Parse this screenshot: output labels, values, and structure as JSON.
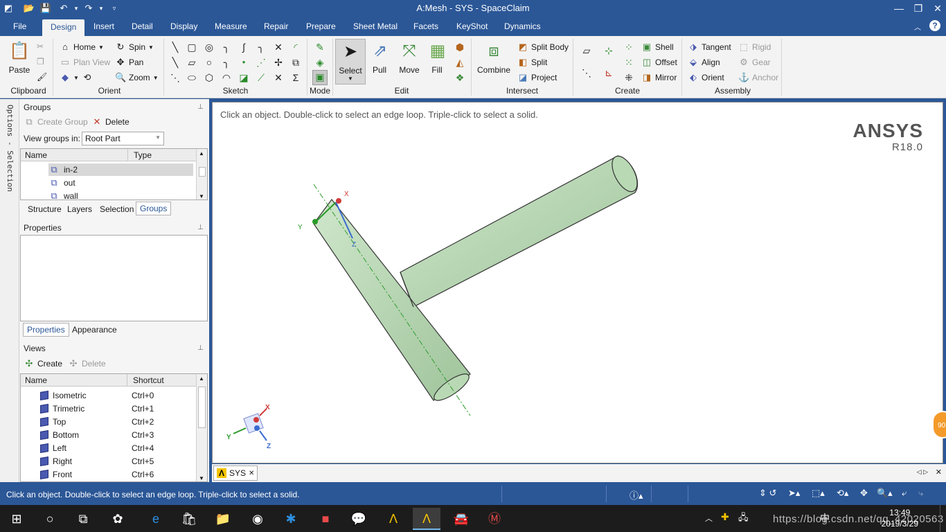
{
  "window": {
    "title": "A:Mesh - SYS - SpaceClaim"
  },
  "tabs": [
    "File",
    "Design",
    "Insert",
    "Detail",
    "Display",
    "Measure",
    "Repair",
    "Prepare",
    "Sheet Metal",
    "Facets",
    "KeyShot",
    "Dynamics"
  ],
  "active_tab": "Design",
  "ribbon": {
    "clipboard": {
      "label": "Clipboard",
      "paste": "Paste"
    },
    "orient": {
      "label": "Orient",
      "home": "Home",
      "spin": "Spin",
      "plan_view": "Plan View",
      "pan": "Pan",
      "zoom": "Zoom"
    },
    "sketch": {
      "label": "Sketch"
    },
    "mode": {
      "label": "Mode"
    },
    "edit": {
      "label": "Edit",
      "select": "Select",
      "pull": "Pull",
      "move": "Move",
      "fill": "Fill"
    },
    "intersect": {
      "label": "Intersect",
      "combine": "Combine",
      "split_body": "Split Body",
      "split": "Split",
      "project": "Project"
    },
    "create": {
      "label": "Create",
      "shell": "Shell",
      "offset": "Offset",
      "mirror": "Mirror"
    },
    "assembly": {
      "label": "Assembly",
      "tangent": "Tangent",
      "align": "Align",
      "orient": "Orient",
      "rigid": "Rigid",
      "gear": "Gear",
      "anchor": "Anchor"
    }
  },
  "left_strip": "Options - Selection",
  "groups_panel": {
    "title": "Groups",
    "create_group": "Create Group",
    "delete": "Delete",
    "view_groups_label": "View groups in:",
    "view_groups_value": "Root Part",
    "columns": [
      "Name",
      "Type"
    ],
    "rows": [
      "in-2",
      "out",
      "wall"
    ],
    "selected_row": "in-2",
    "tabs": [
      "Structure",
      "Layers",
      "Selection",
      "Groups"
    ],
    "active_tab": "Groups"
  },
  "properties_panel": {
    "title": "Properties",
    "tabs": [
      "Properties",
      "Appearance"
    ],
    "active_tab": "Properties"
  },
  "views_panel": {
    "title": "Views",
    "create": "Create",
    "delete": "Delete",
    "columns": [
      "Name",
      "Shortcut"
    ],
    "rows": [
      {
        "name": "Isometric",
        "shortcut": "Ctrl+0"
      },
      {
        "name": "Trimetric",
        "shortcut": "Ctrl+1"
      },
      {
        "name": "Top",
        "shortcut": "Ctrl+2"
      },
      {
        "name": "Bottom",
        "shortcut": "Ctrl+3"
      },
      {
        "name": "Left",
        "shortcut": "Ctrl+4"
      },
      {
        "name": "Right",
        "shortcut": "Ctrl+5"
      },
      {
        "name": "Front",
        "shortcut": "Ctrl+6"
      }
    ]
  },
  "viewport": {
    "hint": "Click an object. Double-click to select an edge loop. Triple-click to select a solid.",
    "brand": "ANSYS",
    "version": "R18.0",
    "axes": {
      "x": "X",
      "y": "Y",
      "z": "Z"
    },
    "body_color": "#b9d9b4"
  },
  "document_tab": "SYS",
  "status_message": "Click an object. Double-click to select an edge loop. Triple-click to select a solid.",
  "side_badge": "90",
  "taskbar": {
    "time": "13:49",
    "date": "2019/3/29",
    "ime": "中",
    "watermark": "https://blog.csdn.net/qq_42020563"
  },
  "colors": {
    "brand_blue": "#2b5797",
    "ribbon_bg": "#f3f3f3"
  }
}
